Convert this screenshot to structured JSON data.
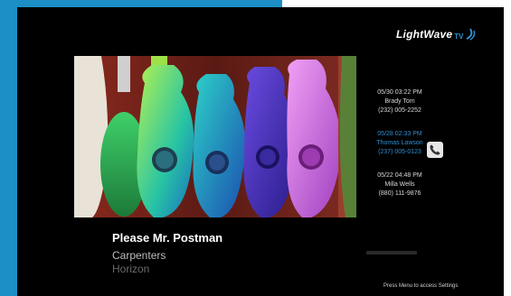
{
  "brand": {
    "logo_text": "LightWave",
    "logo_suffix": "TV",
    "accent_color": "#1b8fc6"
  },
  "now_playing": {
    "title": "Please Mr. Postman",
    "artist": "Carpenters",
    "album": "Horizon",
    "artwork": "colorful-ukuleles"
  },
  "call_log": [
    {
      "datetime": "05/30 03:22 PM",
      "name": "Brady Tom",
      "number": "(232) 005-2252",
      "highlighted": false
    },
    {
      "datetime": "05/28 02:33 PM",
      "name": "Thomas Lawson",
      "number": "(237) 005-0123",
      "highlighted": true
    },
    {
      "datetime": "05/22 04:48 PM",
      "name": "Milla Wells",
      "number": "(880) 111-9876",
      "highlighted": false
    }
  ],
  "phone_icon": "phone-icon",
  "footer_hint": "Press Menu to access Settings"
}
